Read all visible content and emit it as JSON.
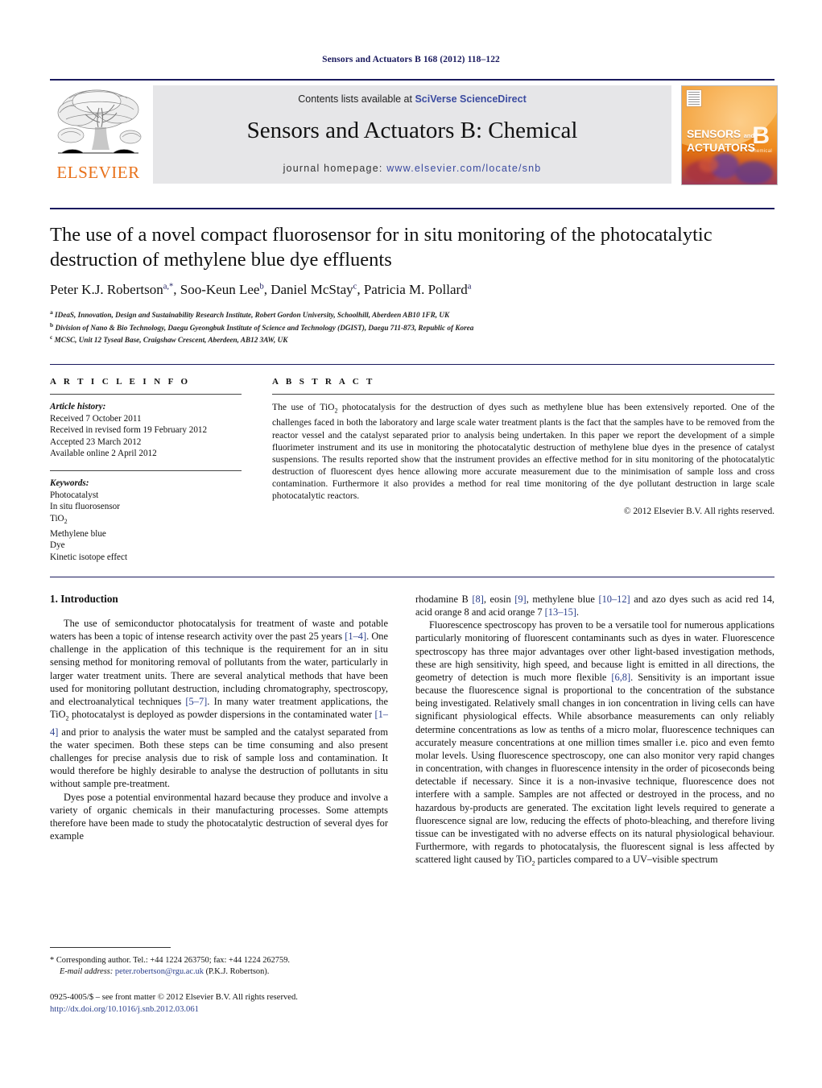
{
  "running_head": "Sensors and Actuators B 168 (2012) 118–122",
  "masthead": {
    "contents_prefix": "Contents lists available at ",
    "sciencedirect": "SciVerse ScienceDirect",
    "journal_name": "Sensors and Actuators B: Chemical",
    "homepage_prefix": "journal homepage: ",
    "homepage_url": "www.elsevier.com/locate/snb",
    "publisher_wordmark": "ELSEVIER",
    "cover": {
      "line1": "SENSORS",
      "and": "and",
      "line2": "ACTUATORS",
      "series": "B",
      "series_sub": "Chemical"
    },
    "accent_orange": "#E8711A",
    "accent_blue": "#3b4ba0",
    "band_grey": "#e6e6e8"
  },
  "article": {
    "title": "The use of a novel compact fluorosensor for in situ monitoring of the photocatalytic destruction of methylene blue dye effluents",
    "authors": [
      {
        "name": "Peter K.J. Robertson",
        "marks": "a,*"
      },
      {
        "name": "Soo-Keun Lee",
        "marks": "b"
      },
      {
        "name": "Daniel McStay",
        "marks": "c"
      },
      {
        "name": "Patricia M. Pollard",
        "marks": "a"
      }
    ],
    "affiliations": [
      {
        "mark": "a",
        "text": "IDeaS, Innovation, Design and Sustainability Research Institute, Robert Gordon University, Schoolhill, Aberdeen AB10 1FR, UK"
      },
      {
        "mark": "b",
        "text": "Division of Nano & Bio Technology, Daegu Gyeongbuk Institute of Science and Technology (DGIST), Daegu 711-873, Republic of Korea"
      },
      {
        "mark": "c",
        "text": "MCSC, Unit 12 Tyseal Base, Craigshaw Crescent, Aberdeen, AB12 3AW, UK"
      }
    ]
  },
  "article_info": {
    "heading": "A R T I C L E   I N F O",
    "history_label": "Article history:",
    "history": [
      "Received 7 October 2011",
      "Received in revised form 19 February 2012",
      "Accepted 23 March 2012",
      "Available online 2 April 2012"
    ],
    "keywords_label": "Keywords:",
    "keywords": [
      "Photocatalyst",
      "In situ fluorosensor",
      "TiO2",
      "Methylene blue",
      "Dye",
      "Kinetic isotope effect"
    ]
  },
  "abstract": {
    "heading": "A B S T R A C T",
    "text_part1": "The use of TiO",
    "text_part1_sub": "2",
    "text_part2": " photocatalysis for the destruction of dyes such as methylene blue has been extensively reported. One of the challenges faced in both the laboratory and large scale water treatment plants is the fact that the samples have to be removed from the reactor vessel and the catalyst separated prior to analysis being undertaken. In this paper we report the development of a simple fluorimeter instrument and its use in monitoring the photocatalytic destruction of methylene blue dyes in the presence of catalyst suspensions. The results reported show that the instrument provides an effective method for in situ monitoring of the photocatalytic destruction of fluorescent dyes hence allowing more accurate measurement due to the minimisation of sample loss and cross contamination. Furthermore it also provides a method for real time monitoring of the dye pollutant destruction in large scale photocatalytic reactors.",
    "copyright": "© 2012 Elsevier B.V. All rights reserved."
  },
  "introduction": {
    "heading": "1.  Introduction",
    "left_p1_a": "The use of semiconductor photocatalysis for treatment of waste and potable waters has been a topic of intense research activity over the past 25 years ",
    "left_p1_ref1": "[1–4]",
    "left_p1_b": ". One challenge in the application of this technique is the requirement for an in situ sensing method for monitoring removal of pollutants from the water, particularly in larger water treatment units. There are several analytical methods that have been used for monitoring pollutant destruction, including chromatography, spectroscopy, and electroanalytical techniques ",
    "left_p1_ref2": "[5–7]",
    "left_p1_c": ". In many water treatment applications, the TiO",
    "left_p1_sub": "2",
    "left_p1_d": " photocatalyst is deployed as powder dispersions in the contaminated water ",
    "left_p1_ref3": "[1–4]",
    "left_p1_e": " and prior to analysis the water must be sampled and the catalyst separated from the water specimen. Both these steps can be time consuming and also present challenges for precise analysis due to risk of sample loss and contamination. It would therefore be highly desirable to analyse the destruction of pollutants in situ without sample pre-treatment.",
    "left_p2": "Dyes pose a potential environmental hazard because they produce and involve a variety of organic chemicals in their manufacturing processes. Some attempts therefore have been made to study the photocatalytic destruction of several dyes for example",
    "right_p1_a": "rhodamine B ",
    "right_p1_ref1": "[8]",
    "right_p1_b": ", eosin ",
    "right_p1_ref2": "[9]",
    "right_p1_c": ", methylene blue ",
    "right_p1_ref3": "[10–12]",
    "right_p1_d": " and azo dyes such as acid red 14, acid orange 8 and acid orange 7 ",
    "right_p1_ref4": "[13–15]",
    "right_p1_e": ".",
    "right_p2_a": "Fluorescence spectroscopy has proven to be a versatile tool for numerous applications particularly monitoring of fluorescent contaminants such as dyes in water. Fluorescence spectroscopy has three major advantages over other light-based investigation methods, these are high sensitivity, high speed, and because light is emitted in all directions, the geometry of detection is much more flexible ",
    "right_p2_ref1": "[6,8]",
    "right_p2_b": ". Sensitivity is an important issue because the fluorescence signal is proportional to the concentration of the substance being investigated. Relatively small changes in ion concentration in living cells can have significant physiological effects. While absorbance measurements can only reliably determine concentrations as low as tenths of a micro molar, fluorescence techniques can accurately measure concentrations at one million times smaller i.e. pico and even femto molar levels. Using fluorescence spectroscopy, one can also monitor very rapid changes in concentration, with changes in fluorescence intensity in the order of picoseconds being detectable if necessary. Since it is a non-invasive technique, fluorescence does not interfere with a sample. Samples are not affected or destroyed in the process, and no hazardous by-products are generated. The excitation light levels required to generate a fluorescence signal are low, reducing the effects of photo-bleaching, and therefore living tissue can be investigated with no adverse effects on its natural physiological behaviour. Furthermore, with regards to photocatalysis, the fluorescent signal is less affected by scattered light caused by TiO",
    "right_p2_sub": "2",
    "right_p2_c": " particles compared to a UV–visible spectrum"
  },
  "footnote": {
    "marker": "*",
    "corresponding": "Corresponding author. Tel.: +44 1224 263750; fax: +44 1224 262759.",
    "email_label": "E-mail address:",
    "email": "peter.robertson@rgu.ac.uk",
    "email_suffix": " (P.K.J. Robertson).",
    "issn_line": "0925-4005/$ – see front matter © 2012 Elsevier B.V. All rights reserved.",
    "doi": "http://dx.doi.org/10.1016/j.snb.2012.03.061"
  }
}
